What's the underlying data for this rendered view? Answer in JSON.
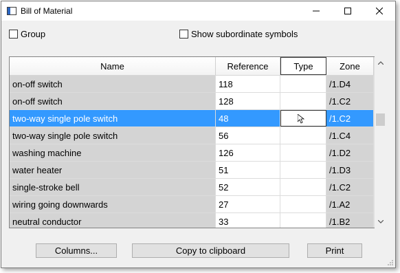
{
  "window": {
    "title": "Bill of Material"
  },
  "titlebar_buttons": [
    "minimize-icon",
    "maximize-icon",
    "close-icon"
  ],
  "options": {
    "group_label": "Group",
    "group_checked": false,
    "subordinate_label": "Show subordinate symbols",
    "subordinate_checked": false
  },
  "table": {
    "columns": [
      "Name",
      "Reference",
      "Type",
      "Zone"
    ],
    "rows": [
      {
        "name": "on-off switch",
        "reference": "118",
        "type": "",
        "zone": "/1.D4"
      },
      {
        "name": "on-off switch",
        "reference": "128",
        "type": "",
        "zone": "/1.C2"
      },
      {
        "name": "two-way single pole switch",
        "reference": "48",
        "type": "",
        "zone": "/1.C2",
        "selected": true
      },
      {
        "name": "two-way single pole switch",
        "reference": "56",
        "type": "",
        "zone": "/1.C4"
      },
      {
        "name": "washing machine",
        "reference": "126",
        "type": "",
        "zone": "/1.D2"
      },
      {
        "name": "water heater",
        "reference": "51",
        "type": "",
        "zone": "/1.D3"
      },
      {
        "name": "single-stroke bell",
        "reference": "52",
        "type": "",
        "zone": "/1.C2"
      },
      {
        "name": "wiring going downwards",
        "reference": "27",
        "type": "",
        "zone": "/1.A2"
      },
      {
        "name": "neutral conductor",
        "reference": "33",
        "type": "",
        "zone": "/1.B2"
      }
    ]
  },
  "buttons": {
    "columns": "Columns...",
    "copy": "Copy to clipboard",
    "print": "Print"
  },
  "colors": {
    "selection": "#3399ff",
    "readonly_cell": "#d4d4d4"
  }
}
